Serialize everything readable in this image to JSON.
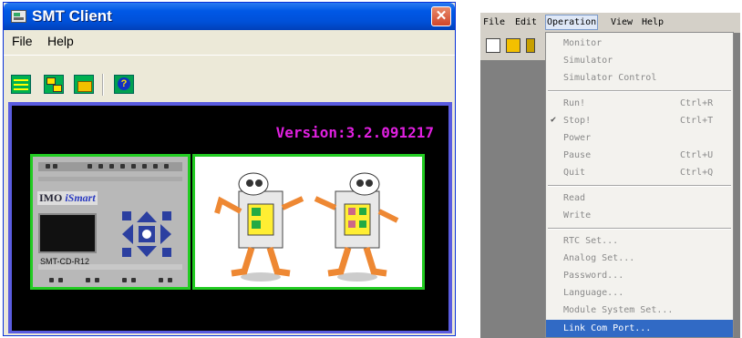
{
  "left_window": {
    "title": "SMT Client",
    "close_glyph": "✕",
    "menu": [
      "File",
      "Help"
    ],
    "toolbar_icons": [
      "connect-icon",
      "transfer-icon",
      "folder-icon",
      "help-icon"
    ],
    "version_text": "Version:3.2.091217",
    "plc": {
      "brand": "IMO",
      "brand_italic": "iSmart",
      "model": "SMT-CD-R12"
    }
  },
  "right_window": {
    "menu": [
      "File",
      "Edit",
      "Operation",
      "View",
      "Help"
    ],
    "active_menu": "Operation",
    "dropdown": [
      {
        "label": "Monitor",
        "shortcut": ""
      },
      {
        "label": "Simulator",
        "shortcut": ""
      },
      {
        "label": "Simulator Control",
        "shortcut": ""
      },
      {
        "separator": true
      },
      {
        "label": "Run!",
        "shortcut": "Ctrl+R"
      },
      {
        "label": "Stop!",
        "shortcut": "Ctrl+T",
        "checked": true
      },
      {
        "label": "Power",
        "shortcut": ""
      },
      {
        "label": "Pause",
        "shortcut": "Ctrl+U"
      },
      {
        "label": "Quit",
        "shortcut": "Ctrl+Q"
      },
      {
        "separator": true
      },
      {
        "label": "Read",
        "shortcut": ""
      },
      {
        "label": "Write",
        "shortcut": ""
      },
      {
        "separator": true
      },
      {
        "label": "RTC Set...",
        "shortcut": ""
      },
      {
        "label": "Analog Set...",
        "shortcut": ""
      },
      {
        "label": "Password...",
        "shortcut": ""
      },
      {
        "label": "Language...",
        "shortcut": ""
      },
      {
        "label": "Module System Set...",
        "shortcut": ""
      },
      {
        "separator": true
      },
      {
        "label": "Link Com Port...",
        "shortcut": "",
        "selected": true
      }
    ]
  },
  "colors": {
    "title_blue": "#0058e6",
    "version_magenta": "#e020e0",
    "panel_green": "#22cc22",
    "highlight_blue": "#316ac5"
  }
}
